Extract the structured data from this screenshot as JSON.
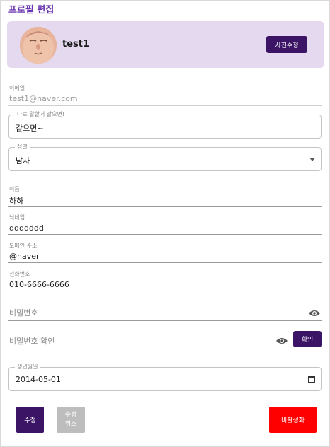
{
  "page": {
    "title": "프로필 편집"
  },
  "profile": {
    "username": "test1",
    "photo_button": "사진수정"
  },
  "fields": {
    "email": {
      "label": "이메일",
      "value": "test1@naver.com"
    },
    "motto": {
      "label": "나로 말할거 같으면!",
      "value": "같으면~"
    },
    "gender": {
      "label": "성별",
      "value": "남자"
    },
    "name": {
      "label": "이름",
      "value": "하하"
    },
    "nickname": {
      "label": "닉네임",
      "value": "ddddddd"
    },
    "domain": {
      "label": "도메인 주소",
      "value": "@naver"
    },
    "phone": {
      "label": "전화번호",
      "value": "010-6666-6666"
    },
    "password": {
      "placeholder": "비밀번호"
    },
    "password_confirm": {
      "placeholder": "비밀번호 확인",
      "button": "확인"
    },
    "birthdate": {
      "label": "생년월일",
      "value": "2014-05-01"
    }
  },
  "actions": {
    "edit": "수정",
    "cancel_line1": "수정",
    "cancel_line2": "취소",
    "deactivate": "비활성화"
  },
  "colors": {
    "accent": "#3b1466",
    "title": "#6a36b0",
    "card_bg": "#e5d9ef",
    "danger": "#ff0000",
    "disabled": "#bdbdbd"
  },
  "icons": {
    "visibility": "eye-icon",
    "dropdown": "caret-down-icon",
    "calendar": "calendar-icon"
  }
}
